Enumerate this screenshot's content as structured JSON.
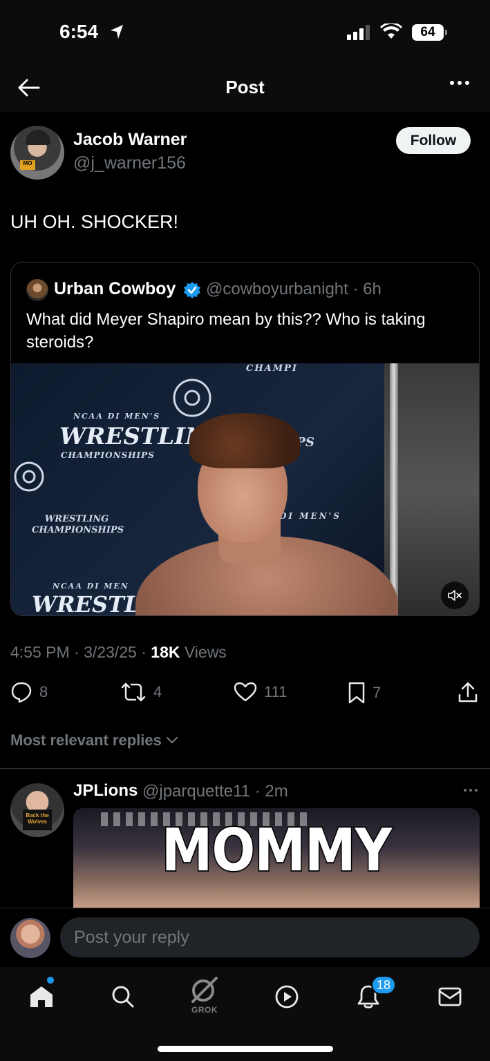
{
  "status_bar": {
    "time": "6:54",
    "battery": "64"
  },
  "header": {
    "title": "Post"
  },
  "post": {
    "author_name": "Jacob Warner",
    "author_handle": "@j_warner156",
    "follow_label": "Follow",
    "text": "UH OH. SHOCKER!",
    "quote": {
      "author_name": "Urban Cowboy",
      "author_handle": "@cowboyurbanight · 6h",
      "text": "What did Meyer Shapiro mean by this?? Who is taking steroids?",
      "video_banner": {
        "line1": "NCAA DI MEN'S",
        "line2": "WRESTLING",
        "line3": "CHAMPIONSHIPS",
        "line4": "WRESTLING CHAMPIONSHIPS",
        "line5": "NCAA DI MEN",
        "line6": "WRESTL",
        "line7": "CHAMPI",
        "line8": "IPS",
        "line9": "DI MEN'S"
      }
    },
    "meta": {
      "time_date": "4:55 PM · 3/23/25 · ",
      "views_count": "18K",
      "views_label": " Views"
    },
    "actions": {
      "replies": "8",
      "reposts": "4",
      "likes": "111",
      "bookmarks": "7"
    }
  },
  "replies_sort": {
    "label": "Most relevant replies"
  },
  "reply": {
    "author_name": "JPLions",
    "author_handle": "@jparquette11 · 2m",
    "media_caption": "MOMMY",
    "avatar_shirt": "Back the Wolves"
  },
  "composer": {
    "placeholder": "Post your reply"
  },
  "tab_bar": {
    "grok_label": "GROK",
    "notifications_badge": "18"
  },
  "colors": {
    "accent": "#1d9bf0",
    "muted": "#71767b",
    "background": "#000000"
  }
}
